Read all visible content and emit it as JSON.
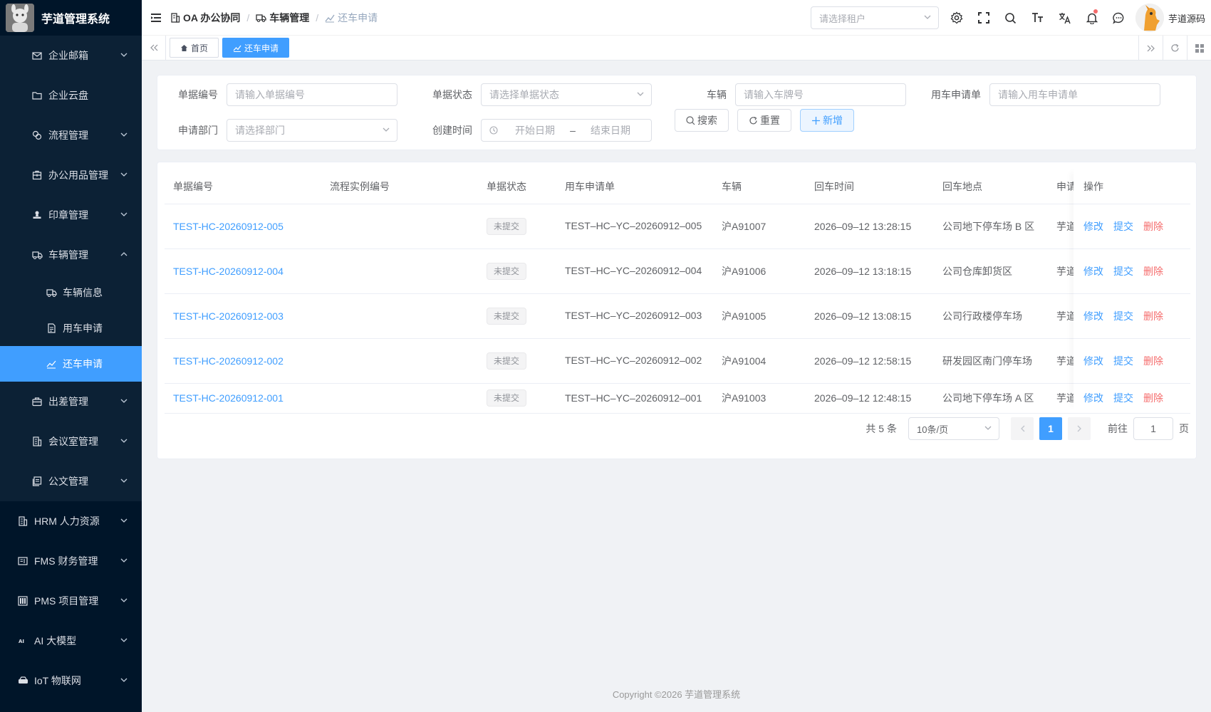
{
  "app": {
    "title": "芋道管理系统",
    "logo_icon": "app-logo"
  },
  "sidebar": {
    "items": [
      {
        "label": "企业邮箱",
        "icon": "mail-icon",
        "expandable": true,
        "level": 2
      },
      {
        "label": "企业云盘",
        "icon": "folder-icon",
        "expandable": false,
        "level": 2
      },
      {
        "label": "流程管理",
        "icon": "flow-icon",
        "expandable": true,
        "level": 2
      },
      {
        "label": "办公用品管理",
        "icon": "package-icon",
        "expandable": true,
        "level": 2
      },
      {
        "label": "印章管理",
        "icon": "stamp-icon",
        "expandable": true,
        "level": 2
      },
      {
        "label": "车辆管理",
        "icon": "car-icon",
        "expandable": true,
        "expanded": true,
        "level": 2
      },
      {
        "label": "车辆信息",
        "icon": "car-icon",
        "level": 3
      },
      {
        "label": "用车申请",
        "icon": "document-icon",
        "level": 3
      },
      {
        "label": "还车申请",
        "icon": "return-icon",
        "level": 3,
        "active": true
      },
      {
        "label": "出差管理",
        "icon": "briefcase-icon",
        "expandable": true,
        "level": 2
      },
      {
        "label": "会议室管理",
        "icon": "building-icon",
        "expandable": true,
        "level": 2
      },
      {
        "label": "公文管理",
        "icon": "files-icon",
        "expandable": true,
        "level": 2
      },
      {
        "label": "HRM 人力资源",
        "icon": "building-icon",
        "expandable": true,
        "level": 1
      },
      {
        "label": "FMS 财务管理",
        "icon": "finance-icon",
        "expandable": true,
        "level": 1
      },
      {
        "label": "PMS 项目管理",
        "icon": "project-icon",
        "expandable": true,
        "level": 1
      },
      {
        "label": "AI 大模型",
        "icon": "ai-icon",
        "expandable": true,
        "level": 1
      },
      {
        "label": "IoT 物联网",
        "icon": "iot-icon",
        "expandable": true,
        "level": 1
      }
    ]
  },
  "header": {
    "breadcrumb": [
      {
        "label": "OA 办公协同",
        "icon": "building-icon"
      },
      {
        "label": "车辆管理",
        "icon": "car-icon"
      },
      {
        "label": "还车申请",
        "icon": "return-icon"
      }
    ],
    "tenant_placeholder": "请选择租户",
    "user_name": "芋道源码"
  },
  "tags": [
    {
      "label": "首页",
      "icon": "home-icon",
      "active": false
    },
    {
      "label": "还车申请",
      "icon": "return-icon",
      "active": true
    }
  ],
  "search": {
    "fields": [
      {
        "label": "单据编号",
        "placeholder": "请输入单据编号",
        "type": "input"
      },
      {
        "label": "单据状态",
        "placeholder": "请选择单据状态",
        "type": "select"
      },
      {
        "label": "车辆",
        "placeholder": "请输入车牌号",
        "type": "input"
      },
      {
        "label": "用车申请单",
        "placeholder": "请输入用车申请单",
        "type": "input"
      },
      {
        "label": "申请部门",
        "placeholder": "请选择部门",
        "type": "select"
      },
      {
        "label": "创建时间",
        "start_placeholder": "开始日期",
        "end_placeholder": "结束日期",
        "separator": "–",
        "type": "daterange"
      }
    ],
    "buttons": {
      "search": "搜索",
      "reset": "重置",
      "add": "新增"
    }
  },
  "table": {
    "columns": [
      "单据编号",
      "流程实例编号",
      "单据状态",
      "用车申请单",
      "车辆",
      "回车时间",
      "回车地点",
      "申请",
      "操作"
    ],
    "rows": [
      {
        "no": "TEST-HC-20260912-005",
        "process": "",
        "status": "未提交",
        "apply": "TEST–HC–YC–20260912–005",
        "car": "沪A91007",
        "time": "2026–09–12 13:28:15",
        "place": "公司地下停车场 B 区",
        "applicant": "芋道"
      },
      {
        "no": "TEST-HC-20260912-004",
        "process": "",
        "status": "未提交",
        "apply": "TEST–HC–YC–20260912–004",
        "car": "沪A91006",
        "time": "2026–09–12 13:18:15",
        "place": "公司仓库卸货区",
        "applicant": "芋道"
      },
      {
        "no": "TEST-HC-20260912-003",
        "process": "",
        "status": "未提交",
        "apply": "TEST–HC–YC–20260912–003",
        "car": "沪A91005",
        "time": "2026–09–12 13:08:15",
        "place": "公司行政楼停车场",
        "applicant": "芋道"
      },
      {
        "no": "TEST-HC-20260912-002",
        "process": "",
        "status": "未提交",
        "apply": "TEST–HC–YC–20260912–002",
        "car": "沪A91004",
        "time": "2026–09–12 12:58:15",
        "place": "研发园区南门停车场",
        "applicant": "芋道"
      },
      {
        "no": "TEST-HC-20260912-001",
        "process": "",
        "status": "未提交",
        "apply": "TEST–HC–YC–20260912–001",
        "car": "沪A91003",
        "time": "2026–09–12 12:48:15",
        "place": "公司地下停车场 A 区",
        "applicant": "芋道"
      }
    ],
    "actions": {
      "edit": "修改",
      "submit": "提交",
      "delete": "删除"
    }
  },
  "pagination": {
    "total_text": "共 5 条",
    "page_size": "10条/页",
    "current_page": "1",
    "goto_label": "前往",
    "goto_value": "1",
    "page_suffix": "页"
  },
  "footer": {
    "copyright": "Copyright ©2026 芋道管理系统"
  },
  "colors": {
    "primary": "#409eff",
    "sidebar_bg": "#001529",
    "danger": "#f56c6c"
  }
}
